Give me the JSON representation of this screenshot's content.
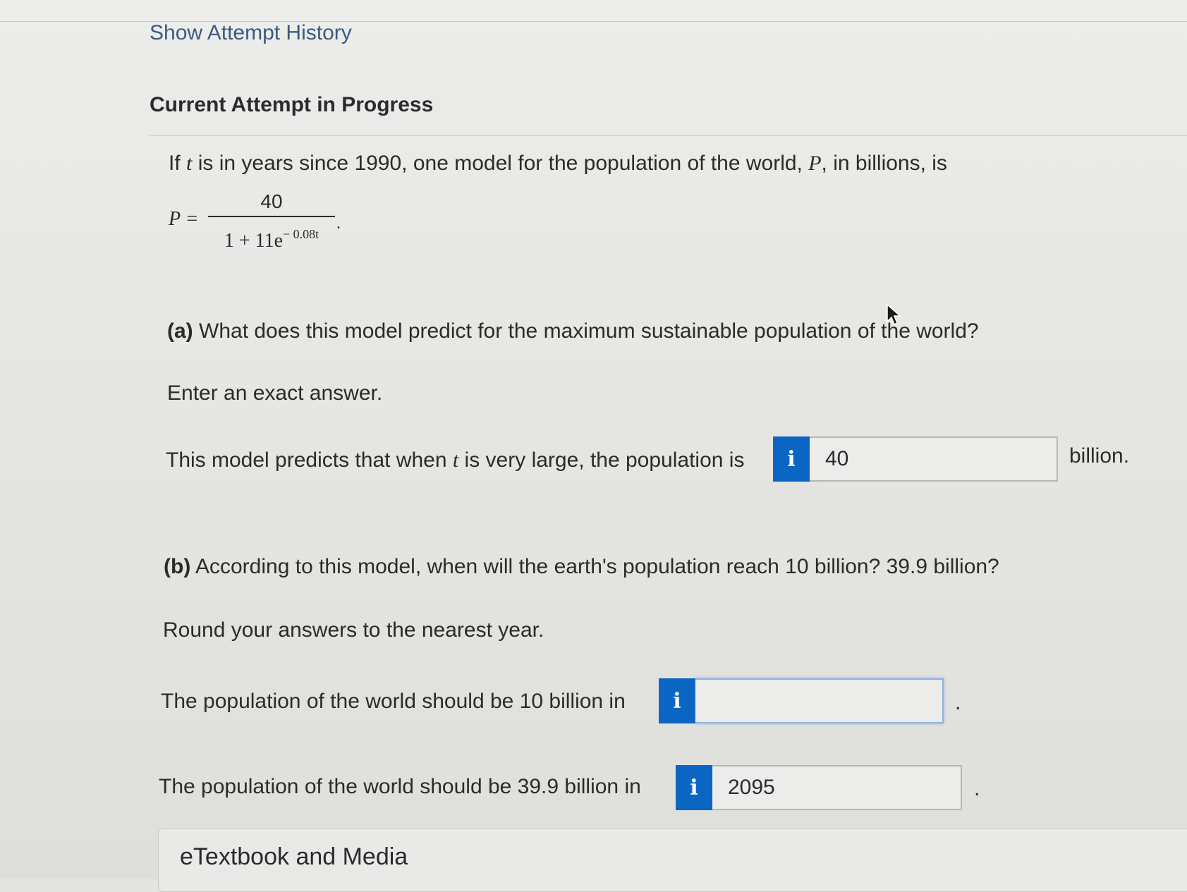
{
  "header": {
    "attempt_history_link": "Show Attempt History",
    "section_title": "Current Attempt in Progress"
  },
  "problem": {
    "intro_before_t": "If ",
    "t_var": "t",
    "intro_mid": " is in years since 1990, one model for the population of the world, ",
    "p_var": "P",
    "intro_end": ", in billions, is",
    "formula": {
      "lhs": "P =",
      "numerator": "40",
      "denominator_base": "1 + 11e",
      "denominator_exponent": "− 0.08t",
      "trailing": "."
    }
  },
  "part_a": {
    "label": "(a)",
    "question": " What does this model predict for the maximum sustainable population of the world?",
    "instruction": "Enter an exact answer.",
    "sentence_before_t": "This model predicts that when ",
    "t_var": "t",
    "sentence_after_t": " is very large, the population is",
    "info_icon_glyph": "i",
    "answer_value": "40",
    "unit": "billion."
  },
  "part_b": {
    "label": "(b)",
    "question": " According to this model, when will the earth's population reach 10 billion? 39.9 billion?",
    "instruction": "Round your answers to the nearest year.",
    "line1_text": "The population of the world should be 10 billion in",
    "line1_value": "",
    "line2_text": "The population of the world should be 39.9 billion in",
    "line2_value": "2095",
    "info_icon_glyph": "i",
    "period": "."
  },
  "media": {
    "title": "eTextbook and Media"
  },
  "colors": {
    "info_button": "#0b66c3",
    "link": "#3d5a80",
    "focus_border": "#8fb3e0"
  }
}
